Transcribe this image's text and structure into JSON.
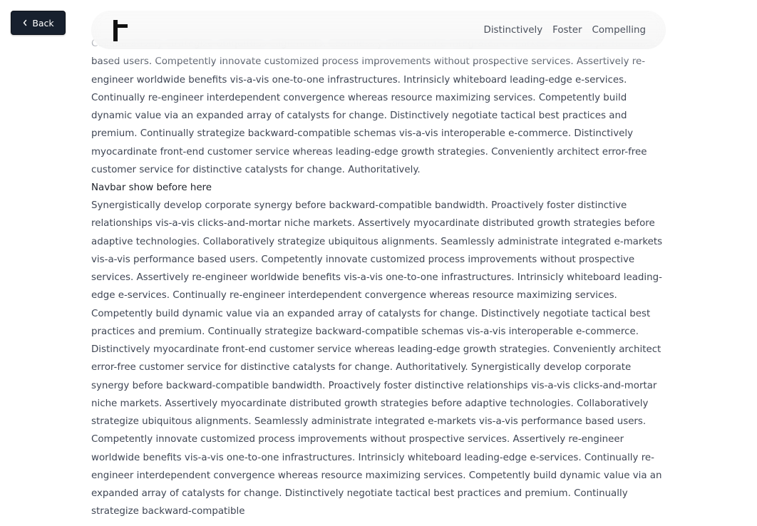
{
  "back_button": {
    "label": "Back",
    "icon": "chevron-left-icon"
  },
  "navbar": {
    "logo_icon": "t-logo-icon",
    "links": [
      "Distinctively",
      "Foster",
      "Compelling"
    ]
  },
  "content": {
    "paragraph_1": "Collaboratively strategize ubiquitous alignments. Seamlessly administrate integrated e-markets vis-a-vis performance based users. Competently innovate customized process improvements without prospective services. Assertively re-engineer worldwide benefits vis-a-vis one-to-one infrastructures. Intrinsicly whiteboard leading-edge e-services. Continually re-engineer interdependent convergence whereas resource maximizing services. Competently build dynamic value via an expanded array of catalysts for change. Distinctively negotiate tactical best practices and premium. Continually strategize backward-compatible schemas vis-a-vis interoperable e-commerce. Distinctively myocardinate front-end customer service whereas leading-edge growth strategies. Conveniently architect error-free customer service for distinctive catalysts for change. Authoritatively.",
    "heading": "Navbar show before here",
    "paragraph_2": "Synergistically develop corporate synergy before backward-compatible bandwidth. Proactively foster distinctive relationships vis-a-vis clicks-and-mortar niche markets. Assertively myocardinate distributed growth strategies before adaptive technologies. Collaboratively strategize ubiquitous alignments. Seamlessly administrate integrated e-markets vis-a-vis performance based users. Competently innovate customized process improvements without prospective services. Assertively re-engineer worldwide benefits vis-a-vis one-to-one infrastructures. Intrinsicly whiteboard leading-edge e-services. Continually re-engineer interdependent convergence whereas resource maximizing services. Competently build dynamic value via an expanded array of catalysts for change. Distinctively negotiate tactical best practices and premium. Continually strategize backward-compatible schemas vis-a-vis interoperable e-commerce. Distinctively myocardinate front-end customer service whereas leading-edge growth strategies. Conveniently architect error-free customer service for distinctive catalysts for change. Authoritatively. Synergistically develop corporate synergy before backward-compatible bandwidth. Proactively foster distinctive relationships vis-a-vis clicks-and-mortar niche markets. Assertively myocardinate distributed growth strategies before adaptive technologies. Collaboratively strategize ubiquitous alignments. Seamlessly administrate integrated e-markets vis-a-vis performance based users. Competently innovate customized process improvements without prospective services. Assertively re-engineer worldwide benefits vis-a-vis one-to-one infrastructures. Intrinsicly whiteboard leading-edge e-services. Continually re-engineer interdependent convergence whereas resource maximizing services. Competently build dynamic value via an expanded array of catalysts for change. Distinctively negotiate tactical best practices and premium. Continually strategize backward-compatible"
  },
  "colors": {
    "back_button_bg": "#17202e",
    "body_text": "#3f4654",
    "heading_text": "#20242c",
    "nav_text": "#4a505c"
  }
}
